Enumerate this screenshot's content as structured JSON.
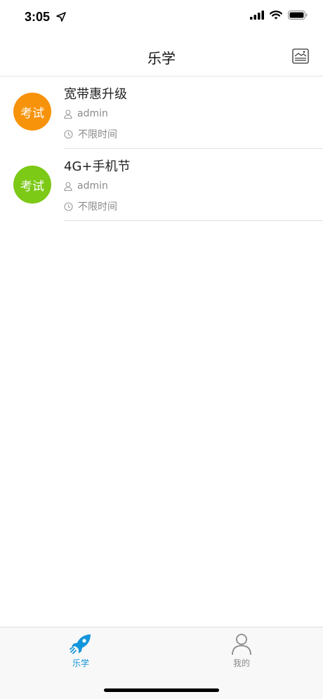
{
  "status_bar": {
    "time": "3:05",
    "icons": [
      "location-arrow-icon",
      "cellular-signal-icon",
      "wifi-icon",
      "battery-icon"
    ]
  },
  "nav": {
    "title": "乐学",
    "action_icon": "image-gallery-icon"
  },
  "items": [
    {
      "badge_text": "考试",
      "badge_color": "#f7930a",
      "title": "宽带惠升级",
      "author": "admin",
      "duration": "不限时间",
      "author_icon": "user-icon",
      "duration_icon": "clock-icon"
    },
    {
      "badge_text": "考试",
      "badge_color": "#7cc916",
      "title": "4G+手机节",
      "author": "admin",
      "duration": "不限时间",
      "author_icon": "user-icon",
      "duration_icon": "clock-icon"
    }
  ],
  "tabs": [
    {
      "label": "乐学",
      "icon": "rocket-icon",
      "active": true,
      "color": "#1296db"
    },
    {
      "label": "我的",
      "icon": "person-icon",
      "active": false,
      "color": "#8a8a8a"
    }
  ]
}
